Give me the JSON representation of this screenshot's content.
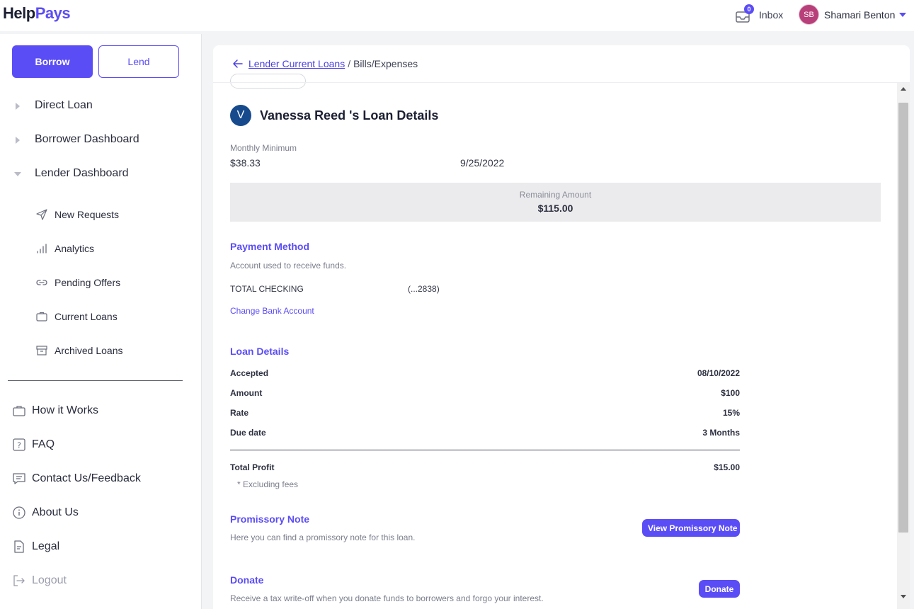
{
  "header": {
    "logo_part1": "Help",
    "logo_part2": "Pays",
    "inbox_count": "0",
    "inbox_label": "Inbox",
    "user_initials": "SB",
    "user_name": "Shamari Benton"
  },
  "sidebar": {
    "borrow_label": "Borrow",
    "lend_label": "Lend",
    "main_items": [
      {
        "label": "Direct Loan",
        "expanded": false
      },
      {
        "label": "Borrower Dashboard",
        "expanded": false
      },
      {
        "label": "Lender Dashboard",
        "expanded": true
      }
    ],
    "sub_items": [
      {
        "label": "New Requests",
        "icon": "send-icon"
      },
      {
        "label": "Analytics",
        "icon": "bar-chart-icon"
      },
      {
        "label": "Pending Offers",
        "icon": "link-icon"
      },
      {
        "label": "Current Loans",
        "icon": "briefcase-icon"
      },
      {
        "label": "Archived Loans",
        "icon": "archive-icon"
      }
    ],
    "footer_items": [
      {
        "label": "How it Works",
        "icon": "briefcase-icon"
      },
      {
        "label": "FAQ",
        "icon": "question-icon"
      },
      {
        "label": "Contact Us/Feedback",
        "icon": "chat-icon"
      },
      {
        "label": "About Us",
        "icon": "info-icon"
      },
      {
        "label": "Legal",
        "icon": "document-icon"
      },
      {
        "label": "Logout",
        "icon": "logout-icon"
      }
    ]
  },
  "breadcrumb": {
    "link": "Lender Current Loans",
    "separator": "/",
    "current": "Bills/Expenses"
  },
  "loan": {
    "avatar_initial": "V",
    "title": "Vanessa Reed 's Loan Details",
    "monthly_minimum_label": "Monthly Minimum",
    "monthly_minimum_value": "$38.33",
    "monthly_date": "9/25/2022",
    "remaining_label": "Remaining Amount",
    "remaining_value": "$115.00"
  },
  "payment_method": {
    "title": "Payment Method",
    "subtitle": "Account used to receive funds.",
    "bank_name": "TOTAL CHECKING",
    "account_mask": "(...2838)",
    "change_link": "Change Bank Account"
  },
  "loan_details": {
    "title": "Loan Details",
    "rows": [
      {
        "key": "Accepted",
        "value": "08/10/2022"
      },
      {
        "key": "Amount",
        "value": "$100"
      },
      {
        "key": "Rate",
        "value": "15%"
      },
      {
        "key": "Due date",
        "value": "3 Months"
      }
    ],
    "total_label": "Total Profit",
    "total_value": "$15.00",
    "note": "* Excluding fees"
  },
  "promissory": {
    "title": "Promissory Note",
    "subtitle": "Here you can find a promissory note for this loan.",
    "button": "View Promissory Note"
  },
  "donate": {
    "title": "Donate",
    "subtitle": "Receive a tax write-off when you donate funds to borrowers and forgo your interest.",
    "button": "Donate"
  },
  "colors": {
    "accent": "#5b4df5",
    "avatar_user": "#b8407a",
    "avatar_borrower": "#174a8c"
  }
}
